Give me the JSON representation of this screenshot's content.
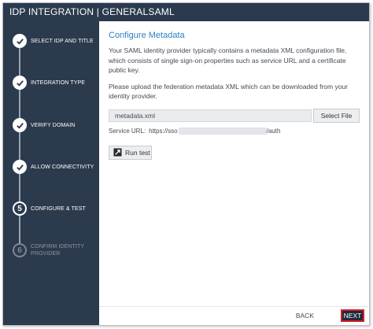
{
  "window": {
    "title": "IDP INTEGRATION | GENERALSAML"
  },
  "sidebar": {
    "steps": [
      {
        "marker": "",
        "label": "SELECT IDP AND TITLE",
        "state": "done"
      },
      {
        "marker": "",
        "label": "INTEGRATION TYPE",
        "state": "done"
      },
      {
        "marker": "",
        "label": "VERIFY DOMAIN",
        "state": "done"
      },
      {
        "marker": "",
        "label": "ALLOW CONNECTIVITY",
        "state": "done"
      },
      {
        "marker": "5",
        "label": "CONFIGURE & TEST",
        "state": "current"
      },
      {
        "marker": "6",
        "label": "CONFIRM IDENTITY PROVIDER",
        "state": "pending"
      }
    ]
  },
  "main": {
    "section_title": "Configure Metadata",
    "description": "Your SAML identity provider typically contains a metadata XML configuration file, which consists of single sign-on properties such as service URL and a certificate public key.",
    "upload_instruction": "Please upload the federation metadata XML which can be downloaded from your identity provider.",
    "file_input_value": "metadata.xml",
    "select_file_label": "Select File",
    "service_url_label": "Service URL:",
    "service_url_prefix": "https://sso",
    "service_url_suffix": "/auth",
    "run_test_label": "Run test"
  },
  "footer": {
    "back_label": "BACK",
    "next_label": "NEXT"
  },
  "colors": {
    "sidebar_bg": "#2c3a4d",
    "accent_title": "#2d80c4",
    "next_highlight": "#d21f2b"
  }
}
